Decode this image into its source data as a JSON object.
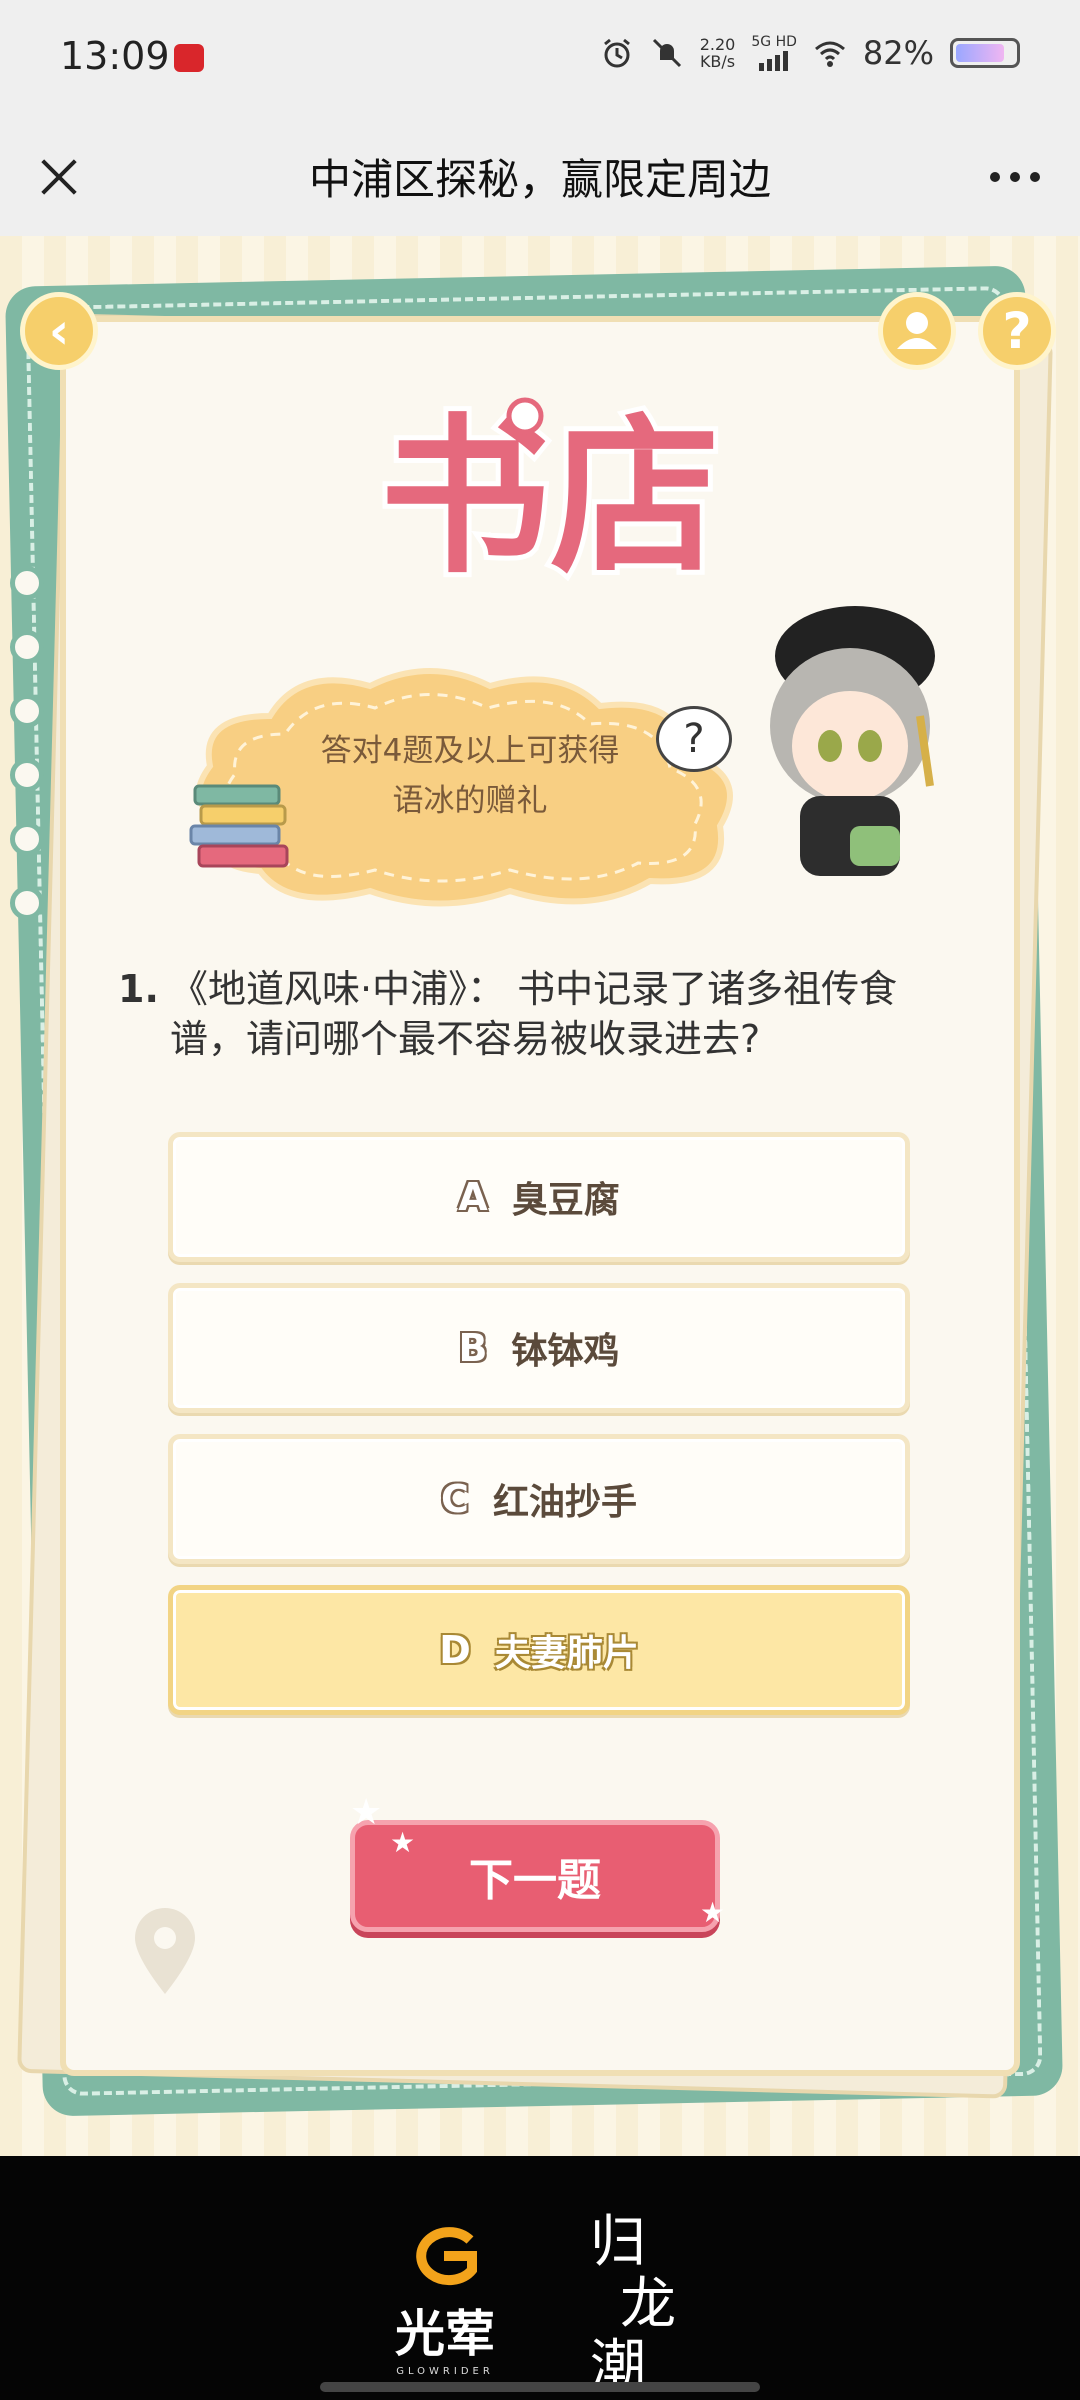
{
  "status_bar": {
    "time": "13:09",
    "network_speed_value": "2.20",
    "network_speed_unit": "KB/s",
    "network_type": "5G HD",
    "battery": "82%",
    "battery_level": 0.82
  },
  "title_bar": {
    "title": "中浦区探秘，赢限定周边"
  },
  "game": {
    "logo_text": "书店",
    "reward_text_line1": "答对4题及以上可获得",
    "reward_text_line2": "语冰的赠礼",
    "bubble_text": "?",
    "question_number": "1.",
    "question_text": "《地道风味·中浦》： 书中记录了诸多祖传食谱，请问哪个最不容易被收录进去?",
    "options": [
      {
        "letter": "A",
        "label": "臭豆腐"
      },
      {
        "letter": "B",
        "label": "钵钵鸡"
      },
      {
        "letter": "C",
        "label": "红油抄手"
      },
      {
        "letter": "D",
        "label": "夫妻肺片"
      }
    ],
    "selected_option": "D",
    "next_button": "下一题",
    "back_icon_glyph": "‹",
    "help_icon_glyph": "?"
  },
  "footer": {
    "brand1_name": "光荤",
    "brand1_sub": "GLOWRIDER",
    "brand2_name_line1": "归",
    "brand2_name_line2": "龙",
    "brand2_name_line3": "潮"
  },
  "colors": {
    "accent_pink": "#e85e72",
    "accent_yellow": "#f6cf6b",
    "board_green": "#7fb8a3",
    "selected_option_bg": "#fde7a5"
  }
}
